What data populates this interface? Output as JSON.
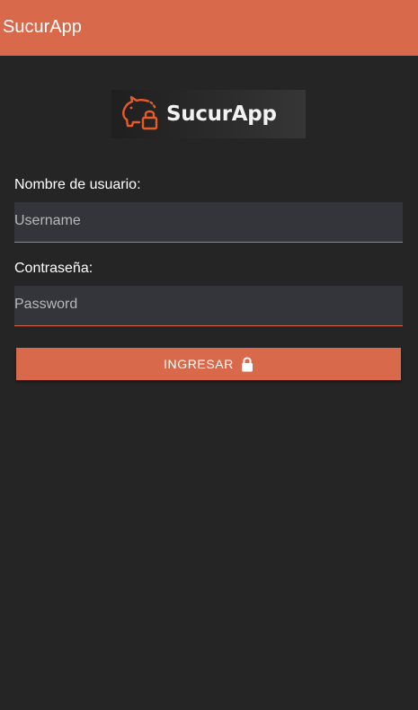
{
  "app": {
    "title": "SucurApp",
    "accent_color": "#d9694b",
    "background_color": "#252525"
  },
  "logo": {
    "text": "SucurApp",
    "icon": "piggy-bank-lock-icon"
  },
  "form": {
    "username_label": "Nombre de usuario:",
    "username_placeholder": "Username",
    "username_value": "",
    "password_label": "Contraseña:",
    "password_placeholder": "Password",
    "password_value": "",
    "submit_label": "INGRESAR",
    "submit_icon": "lock-icon"
  }
}
